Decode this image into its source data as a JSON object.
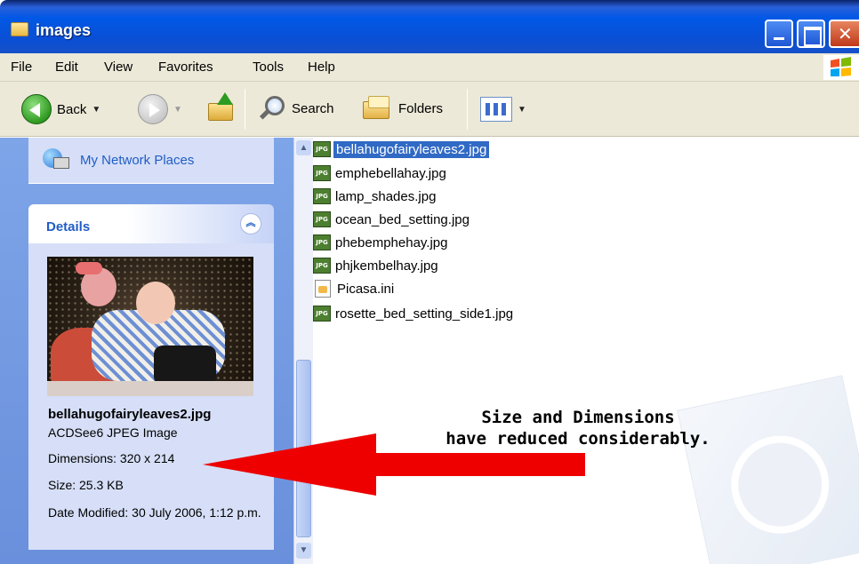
{
  "window": {
    "title": "images"
  },
  "menu": [
    "File",
    "Edit",
    "View",
    "Favorites",
    "Tools",
    "Help"
  ],
  "toolbar": {
    "back": "Back",
    "search": "Search",
    "folders": "Folders"
  },
  "sidebar": {
    "places_link": "My Network Places",
    "details_title": "Details",
    "file_name": "bellahugofairyleaves2.jpg",
    "file_type": "ACDSee6 JPEG Image",
    "dimensions": "Dimensions: 320 x 214",
    "size": "Size: 25.3 KB",
    "date_modified": "Date Modified: 30 July 2006, 1:12 p.m."
  },
  "files": [
    {
      "name": "bellahugofairyleaves2.jpg",
      "icon": "jpeg-icon",
      "selected": true
    },
    {
      "name": "emphebellahay.jpg",
      "icon": "jpeg-icon"
    },
    {
      "name": "lamp_shades.jpg",
      "icon": "jpeg-icon"
    },
    {
      "name": "ocean_bed_setting.jpg",
      "icon": "jpeg-icon"
    },
    {
      "name": "phebemphehay.jpg",
      "icon": "jpeg-icon"
    },
    {
      "name": "phjkembelhay.jpg",
      "icon": "jpeg-icon"
    },
    {
      "name": "Picasa.ini",
      "icon": "ini-file-icon"
    },
    {
      "name": "rosette_bed_setting_side1.jpg",
      "icon": "jpeg-icon"
    }
  ],
  "annotation": {
    "line1": "Size and Dimensions",
    "line2": "have reduced considerably.",
    "arrow_color": "#ee0000"
  },
  "colors": {
    "titlebar": "#0058e6",
    "selection": "#316ac5",
    "link": "#215dc6"
  }
}
